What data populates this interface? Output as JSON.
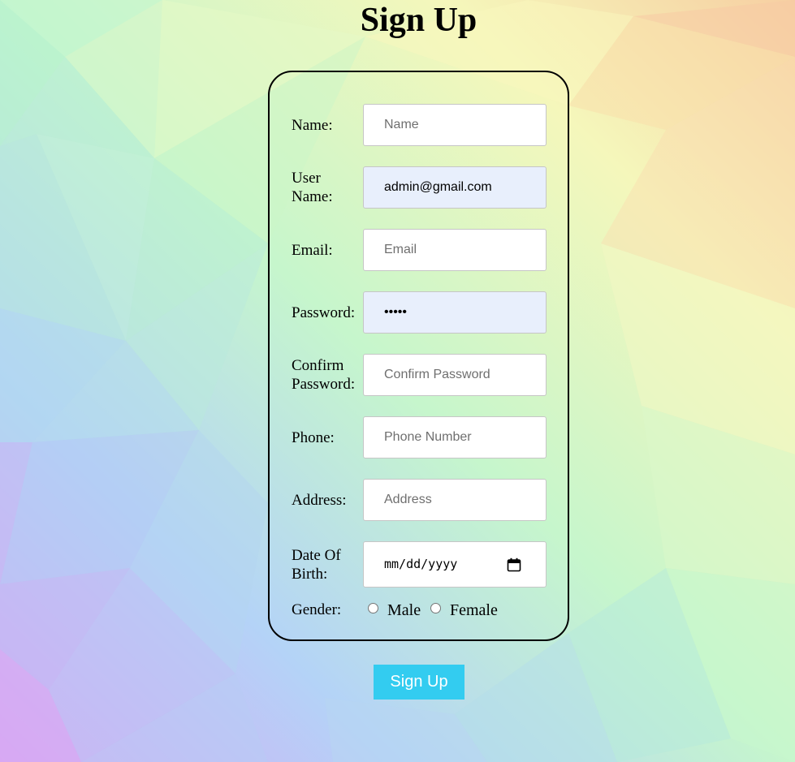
{
  "page": {
    "title": "Sign Up"
  },
  "form": {
    "fields": [
      {
        "label": "Name:",
        "placeholder": "Name",
        "value": ""
      },
      {
        "label": "User Name:",
        "placeholder": "",
        "value": "admin@gmail.com"
      },
      {
        "label": "Email:",
        "placeholder": "Email",
        "value": ""
      },
      {
        "label": "Password:",
        "placeholder": "",
        "value": "•••••"
      },
      {
        "label": "Confirm Password:",
        "placeholder": "Confirm Password",
        "value": ""
      },
      {
        "label": "Phone:",
        "placeholder": "Phone Number",
        "value": ""
      },
      {
        "label": "Address:",
        "placeholder": "Address",
        "value": ""
      }
    ],
    "dob": {
      "label": "Date Of Birth:",
      "placeholder": "mm/dd/yyyy",
      "icon": "calendar-icon"
    },
    "gender": {
      "label": "Gender:",
      "options": [
        "Male",
        "Female"
      ],
      "selected": ""
    },
    "submit_label": "Sign Up"
  },
  "colors": {
    "button_bg": "#33ccf0",
    "autofill_bg": "#e8effc",
    "card_border": "#000000"
  }
}
